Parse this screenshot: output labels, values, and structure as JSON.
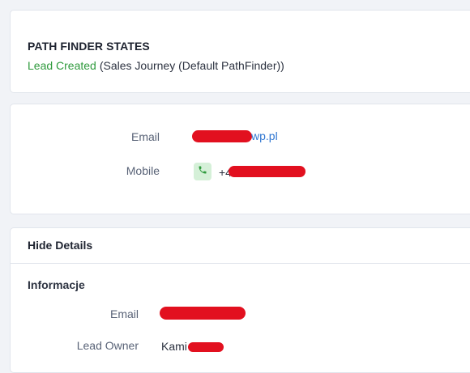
{
  "path_finder": {
    "title": "PATH FINDER STATES",
    "state": "Lead Created",
    "journey": "(Sales Journey (Default PathFinder))"
  },
  "contact": {
    "email_label": "Email",
    "email_value_visible": "wp.pl",
    "mobile_label": "Mobile",
    "mobile_value_visible": "+4"
  },
  "details": {
    "toggle_label": "Hide Details",
    "section_title": "Informacje",
    "email_label": "Email",
    "lead_owner_label": "Lead Owner",
    "lead_owner_value_visible": "Kami"
  },
  "colors": {
    "accent_green": "#2e9a3c",
    "link_blue": "#3278d2",
    "redaction_red": "#e2101f"
  },
  "icons": {
    "phone": "phone-icon"
  }
}
